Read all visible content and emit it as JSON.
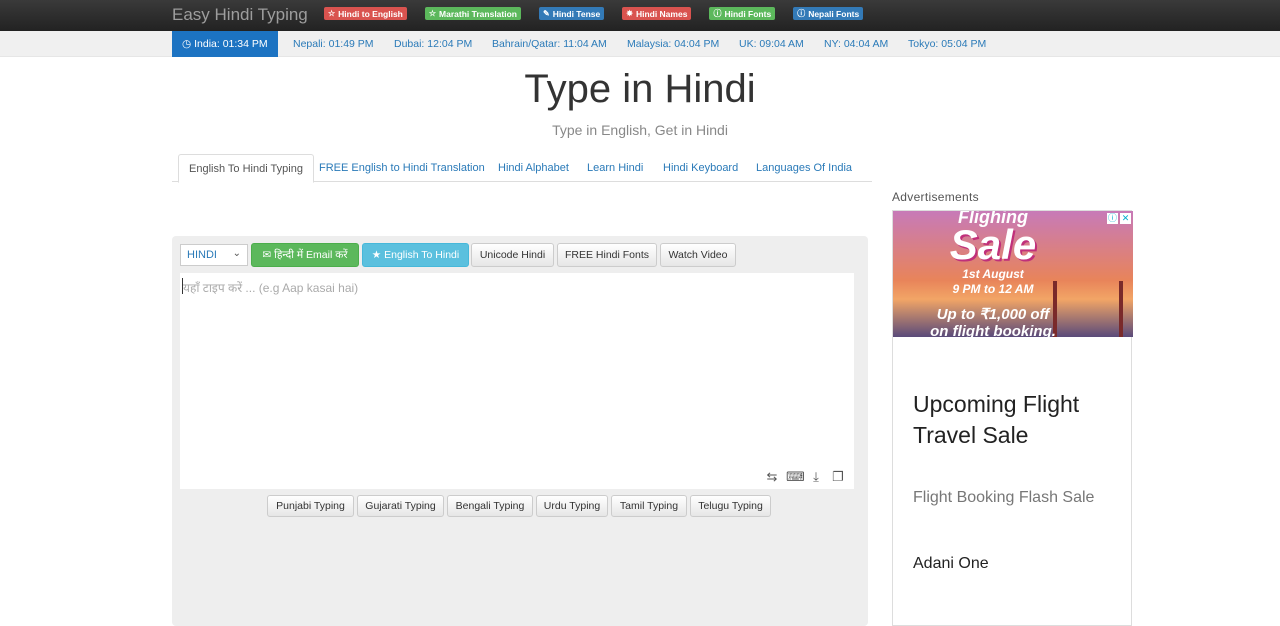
{
  "brand": "Easy Hindi Typing",
  "nav_badges": [
    {
      "icon": "☆",
      "label": "Hindi to English",
      "color": "#d9534f"
    },
    {
      "icon": "☆",
      "label": "Marathi Translation",
      "color": "#5cb85c"
    },
    {
      "icon": "✎",
      "label": "Hindi Tense",
      "color": "#337ab7"
    },
    {
      "icon": "✸",
      "label": "Hindi Names",
      "color": "#d9534f"
    },
    {
      "icon": "ⓘ",
      "label": "Hindi Fonts",
      "color": "#5cb85c"
    },
    {
      "icon": "ⓘ",
      "label": "Nepali Fonts",
      "color": "#337ab7"
    }
  ],
  "times": [
    {
      "label": "India: 01:34 PM",
      "active": true
    },
    {
      "label": "Nepali: 01:49 PM"
    },
    {
      "label": "Dubai: 12:04 PM"
    },
    {
      "label": "Bahrain/Qatar: 11:04 AM"
    },
    {
      "label": "Malaysia: 04:04 PM"
    },
    {
      "label": "UK: 09:04 AM"
    },
    {
      "label": "NY: 04:04 AM"
    },
    {
      "label": "Tokyo: 05:04 PM"
    }
  ],
  "title": "Type in Hindi",
  "subtitle": "Type in English, Get in Hindi",
  "tabs": [
    "English To Hindi Typing",
    "FREE English to Hindi Translation",
    "Hindi Alphabet",
    "Learn Hindi",
    "Hindi Keyboard",
    "Languages Of India"
  ],
  "editor": {
    "language": "HINDI",
    "email_btn": "✉ हिन्दी में Email करें",
    "eng_btn": "★ English To Hindi",
    "unicode_btn": "Unicode Hindi",
    "fonts_btn": "FREE Hindi Fonts",
    "video_btn": "Watch Video",
    "placeholder": "यहाँ टाइप करें ... (e.g Aap kasai hai)"
  },
  "other_typing": [
    "Punjabi Typing",
    "Gujarati Typing",
    "Bengali Typing",
    "Urdu Typing",
    "Tamil Typing",
    "Telugu Typing"
  ],
  "ad": {
    "label": "Advertisements",
    "image_top": "Flighing",
    "image_sale": "Sale",
    "image_date": "1st August",
    "image_time": "9 PM to 12 AM",
    "image_offer1": "Up to ₹1,000 off",
    "image_offer2": "on flight booking.",
    "headline": "Upcoming Flight Travel Sale",
    "subline": "Flight Booking Flash Sale",
    "advertiser": "Adani One"
  }
}
